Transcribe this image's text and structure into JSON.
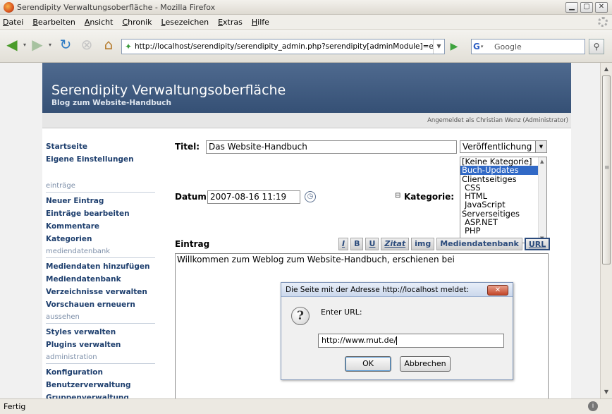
{
  "window": {
    "title": "Serendipity Verwaltungsoberfläche - Mozilla Firefox",
    "buttons": [
      "minimize",
      "maximize",
      "close"
    ]
  },
  "menu": [
    "Datei",
    "Bearbeiten",
    "Ansicht",
    "Chronik",
    "Lesezeichen",
    "Extras",
    "Hilfe"
  ],
  "toolbar": {
    "url": "http://localhost/serendipity/serendipity_admin.php?serendipity[adminModule]=e",
    "search_engine": "G",
    "search_placeholder": "Google"
  },
  "page": {
    "title": "Serendipity Verwaltungsoberfläche",
    "subtitle": "Blog zum Website-Handbuch",
    "login_info": "Angemeldet als Christian Wenz (Administrator)"
  },
  "sidebar": {
    "top": [
      "Startseite",
      "Eigene Einstellungen"
    ],
    "sections": [
      {
        "heading": "einträge",
        "items": [
          "Neuer Eintrag",
          "Einträge bearbeiten",
          "Kommentare",
          "Kategorien"
        ]
      },
      {
        "heading": "mediendatenbank",
        "items": [
          "Mediendaten hinzufügen",
          "Mediendatenbank",
          "Verzeichnisse verwalten",
          "Vorschauen erneuern"
        ]
      },
      {
        "heading": "aussehen",
        "items": [
          "Styles verwalten",
          "Plugins verwalten"
        ]
      },
      {
        "heading": "administration",
        "items": [
          "Konfiguration",
          "Benutzerverwaltung",
          "Gruppenverwaltung"
        ]
      }
    ]
  },
  "form": {
    "title_label": "Titel:",
    "title_value": "Das Website-Handbuch",
    "status_value": "Veröffentlichung",
    "date_label": "Datum:",
    "date_value": "2007-08-16 11:19",
    "category_label": "Kategorie:",
    "categories": [
      {
        "label": "[Keine Kategorie]",
        "selected": false,
        "indent": false
      },
      {
        "label": "Buch-Updates",
        "selected": true,
        "indent": false
      },
      {
        "label": "Clientseitiges",
        "selected": false,
        "indent": false
      },
      {
        "label": "CSS",
        "selected": false,
        "indent": true
      },
      {
        "label": "HTML",
        "selected": false,
        "indent": true
      },
      {
        "label": "JavaScript",
        "selected": false,
        "indent": true
      },
      {
        "label": "Serverseitiges",
        "selected": false,
        "indent": false
      },
      {
        "label": "ASP.NET",
        "selected": false,
        "indent": true
      },
      {
        "label": "PHP",
        "selected": false,
        "indent": true
      }
    ],
    "entry_label": "Eintrag",
    "editor_buttons": [
      "I",
      "B",
      "U",
      "Zitat",
      "img",
      "Mediendatenbank",
      "URL"
    ],
    "entry_text": "Willkommen zum Weblog zum Website-Handbuch, erschienen bei"
  },
  "dialog": {
    "title": "Die Seite mit der Adresse http://localhost meldet:",
    "prompt": "Enter URL:",
    "input_value": "http://www.mut.de/",
    "ok_label": "OK",
    "cancel_label": "Abbrechen"
  },
  "status": {
    "text": "Fertig"
  },
  "colors": {
    "header_bg": "#4f6a8f",
    "link": "#1e3f6e",
    "selected_option": "#3169c6"
  }
}
